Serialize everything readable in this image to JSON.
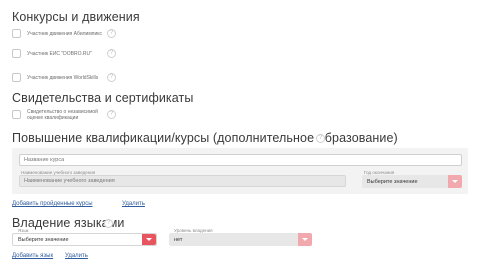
{
  "contests": {
    "title": "Конкурсы и движения",
    "items": [
      {
        "label": "Участник движения Абилимпикс"
      },
      {
        "label": "Участник ЕИС \"DOBRO.RU\""
      },
      {
        "label": "Участник движения WorldSkills"
      }
    ]
  },
  "certificates": {
    "title": "Свидетельства и сертификаты",
    "item_line1": "Свидетельство о независимой",
    "item_line2": "оценке квалификации"
  },
  "training": {
    "title": "Повышение квалификации/курсы (дополнительное образование)",
    "course_placeholder": "Название курса",
    "institution_label": "Наименование учебного заведения",
    "institution_placeholder": "Наименование учебного заведения",
    "year_label": "Год окончания",
    "year_value": "Выберите значение",
    "add_link": "Добавить пройденные курсы",
    "remove_link": "Удалить"
  },
  "languages": {
    "title": "Владение языками",
    "language_label": "Язык",
    "language_value": "Выберите значение",
    "level_label": "Уровень владения",
    "level_value": "нет",
    "add_link": "Добавить язык",
    "remove_link": "Удалить"
  },
  "colors": {
    "accent_red": "#e8555f",
    "accent_red_light": "#f2a9ae",
    "link_blue": "#2f5c9c"
  },
  "icons": {
    "help": "?"
  }
}
